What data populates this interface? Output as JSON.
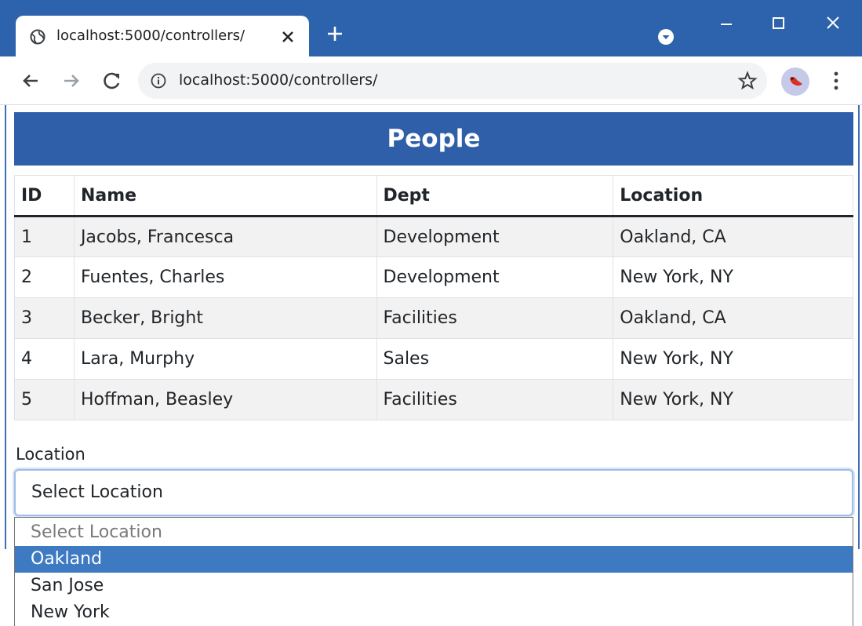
{
  "browser": {
    "tab_title": "localhost:5000/controllers/",
    "url": "localhost:5000/controllers/"
  },
  "page": {
    "title": "People",
    "table": {
      "headers": [
        "ID",
        "Name",
        "Dept",
        "Location"
      ],
      "rows": [
        [
          "1",
          "Jacobs, Francesca",
          "Development",
          "Oakland, CA"
        ],
        [
          "2",
          "Fuentes, Charles",
          "Development",
          "New York, NY"
        ],
        [
          "3",
          "Becker, Bright",
          "Facilities",
          "Oakland, CA"
        ],
        [
          "4",
          "Lara, Murphy",
          "Sales",
          "New York, NY"
        ],
        [
          "5",
          "Hoffman, Beasley",
          "Facilities",
          "New York, NY"
        ]
      ]
    },
    "location_select": {
      "label": "Location",
      "value": "Select Location",
      "options": [
        "Select Location",
        "Oakland",
        "San Jose",
        "New York"
      ],
      "highlighted": "Oakland"
    }
  },
  "colors": {
    "titlebar": "#2d63ad",
    "banner": "#2f5fa8",
    "option_highlight": "#3d7ac2"
  },
  "icons": [
    "globe-icon",
    "close-icon",
    "plus-icon",
    "chevron-down-icon",
    "minimize-icon",
    "maximize-icon",
    "back-arrow-icon",
    "forward-arrow-icon",
    "reload-icon",
    "info-icon",
    "star-icon",
    "avatar-icon",
    "more-vert-icon"
  ]
}
